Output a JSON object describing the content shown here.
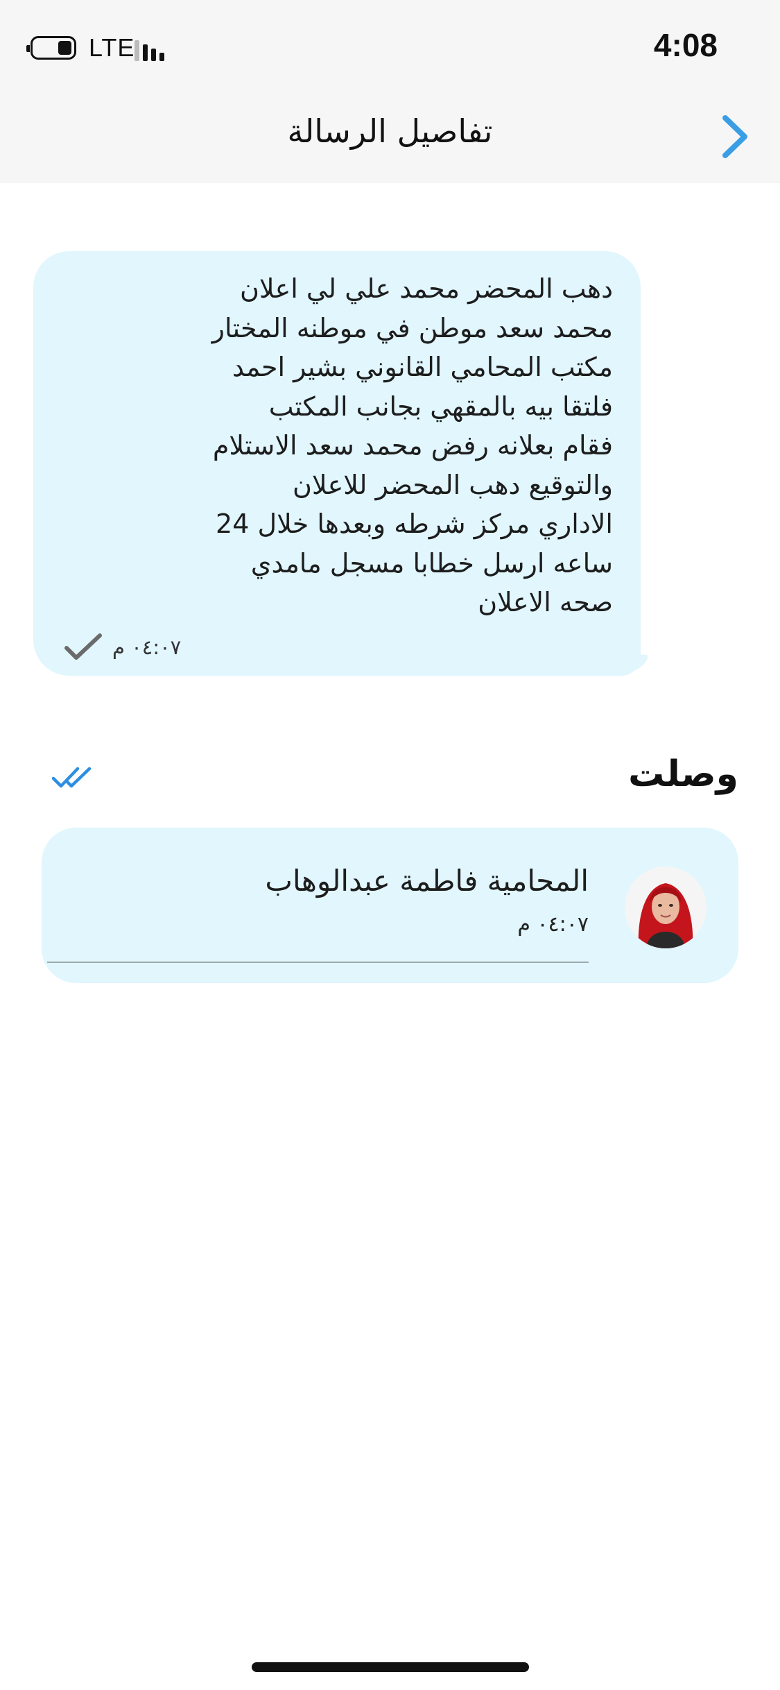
{
  "status_bar": {
    "time": "4:08",
    "network": "LTE",
    "battery_level": 0.35,
    "signal_bars": 3
  },
  "nav": {
    "title": "تفاصيل الرسالة",
    "back_icon": "chevron-right-icon",
    "accent_color": "#3a9ee5"
  },
  "message": {
    "text": "دهب المحضر محمد علي لي اعلان\nمحمد سعد موطن في موطنه المختار\nمكتب المحامي القانوني بشير احمد\nفلتقا بيه بالمقهي بجانب المكتب\nفقام بعلانه رفض محمد سعد الاستلام\nوالتوقيع دهب المحضر للاعلان\nالاداري مركز شرطه وبعدها خلال 24\nساعه ارسل خطابا مسجل مامدي\nصحه الاعلان",
    "time": "٠٤:٠٧ م",
    "status_icon": "single-check-icon",
    "bubble_color": "#e1f6fd"
  },
  "delivered": {
    "title": "وصلت",
    "status_icon": "double-check-icon",
    "check_color": "#2e8fe0"
  },
  "recipient": {
    "name": "المحامية فاطمة عبدالوهاب",
    "time": "٠٤:٠٧ م",
    "avatar_icon": "user-avatar"
  }
}
